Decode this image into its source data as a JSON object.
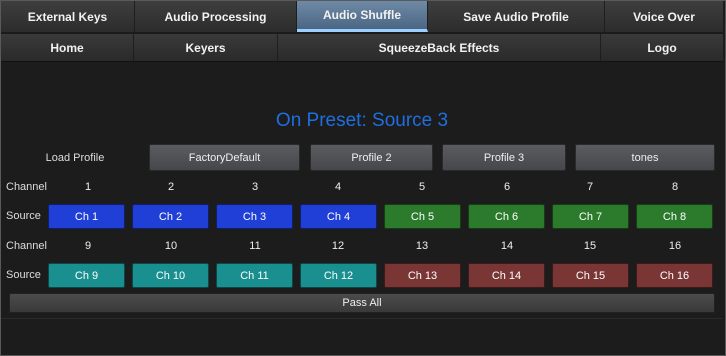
{
  "tabs_top": [
    "External Keys",
    "Audio Processing",
    "Audio Shuffle",
    "Save Audio Profile",
    "Voice Over"
  ],
  "tabs_second": [
    "Home",
    "Keyers",
    "SqueezeBack Effects",
    "Logo"
  ],
  "active_tab": "Audio Shuffle",
  "preset_title": "On Preset: Source 3",
  "load_profile_label": "Load Profile",
  "profiles": [
    "FactoryDefault",
    "Profile 2",
    "Profile 3",
    "tones"
  ],
  "row_labels": {
    "channel": "Channel",
    "source": "Source"
  },
  "channels_row1": [
    "1",
    "2",
    "3",
    "4",
    "5",
    "6",
    "7",
    "8"
  ],
  "sources_row1": [
    "Ch 1",
    "Ch 2",
    "Ch 3",
    "Ch 4",
    "Ch 5",
    "Ch 6",
    "Ch 7",
    "Ch 8"
  ],
  "channels_row2": [
    "9",
    "10",
    "11",
    "12",
    "13",
    "14",
    "15",
    "16"
  ],
  "sources_row2": [
    "Ch 9",
    "Ch 10",
    "Ch 11",
    "Ch 12",
    "Ch 13",
    "Ch 14",
    "Ch 15",
    "Ch 16"
  ],
  "pass_all_label": "Pass All",
  "colors": {
    "title_blue": "#1f6ee0",
    "blue": "#1f3fd6",
    "green": "#2c7a2c",
    "teal": "#1a8f8f",
    "red": "#7a3535",
    "active_tab": "#5a7896"
  }
}
